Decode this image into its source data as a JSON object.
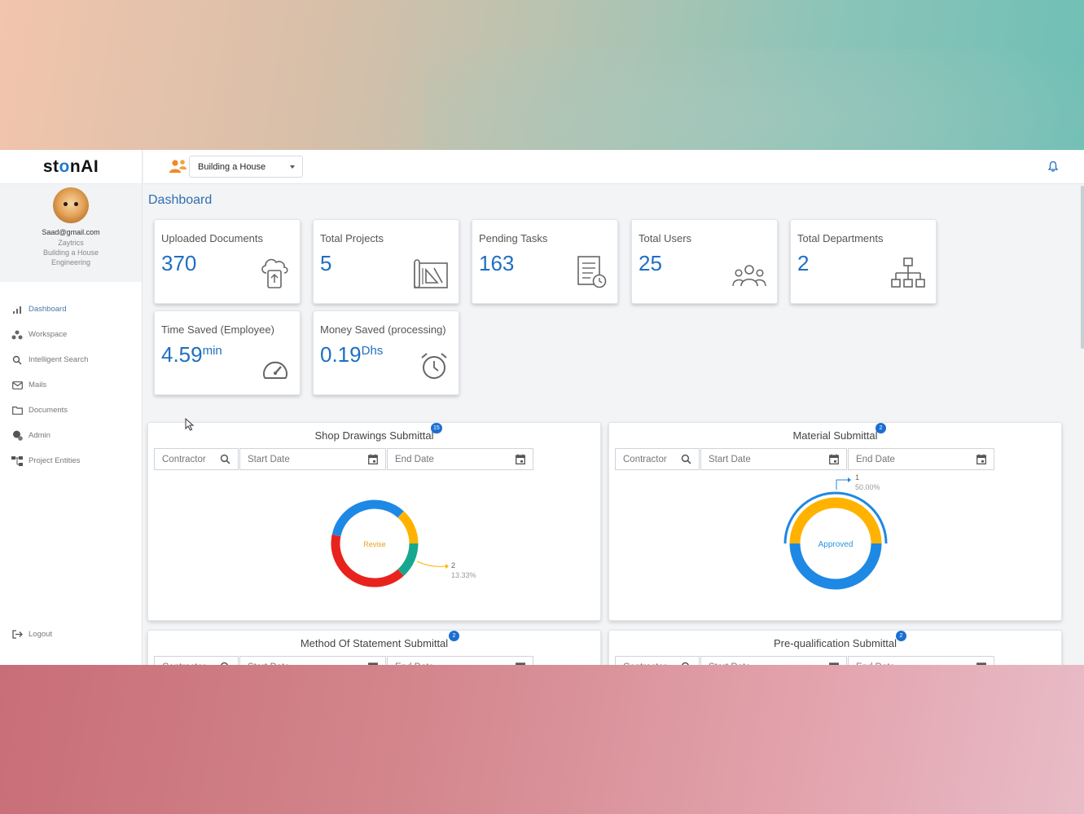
{
  "app": {
    "logo": {
      "pre": "st",
      "o": "o",
      "post": "nAI"
    }
  },
  "profile": {
    "email": "Saad@gmail.com",
    "company": "Zaytrics",
    "project": "Building a House",
    "department": "Engineering"
  },
  "nav": {
    "items": [
      {
        "label": "Dashboard",
        "icon": "bar-chart-icon"
      },
      {
        "label": "Workspace",
        "icon": "workspace-icon"
      },
      {
        "label": "Intelligent Search",
        "icon": "search-icon"
      },
      {
        "label": "Mails",
        "icon": "mail-icon"
      },
      {
        "label": "Documents",
        "icon": "folder-icon"
      },
      {
        "label": "Admin",
        "icon": "admin-icon"
      },
      {
        "label": "Project Entities",
        "icon": "hierarchy-icon"
      }
    ],
    "logout": "Logout"
  },
  "topbar": {
    "project_select": "Building a House"
  },
  "page": {
    "title": "Dashboard"
  },
  "stats": [
    {
      "label": "Uploaded Documents",
      "value": "370",
      "unit": "",
      "icon": "cloud-upload-icon"
    },
    {
      "label": "Total Projects",
      "value": "5",
      "unit": "",
      "icon": "blueprint-icon"
    },
    {
      "label": "Pending Tasks",
      "value": "163",
      "unit": "",
      "icon": "task-clock-icon"
    },
    {
      "label": "Total Users",
      "value": "25",
      "unit": "",
      "icon": "users-icon"
    },
    {
      "label": "Total Departments",
      "value": "2",
      "unit": "",
      "icon": "org-chart-icon"
    },
    {
      "label": "Time Saved (Employee)",
      "value": "4.59",
      "unit": "min",
      "icon": "speedometer-icon"
    },
    {
      "label": "Money Saved (processing)",
      "value": "0.19",
      "unit": "Dhs",
      "icon": "alarm-clock-icon"
    }
  ],
  "filters": {
    "contractor": "Contractor",
    "start_date": "Start Date",
    "end_date": "End Date"
  },
  "panels": [
    {
      "title": "Shop Drawings Submittal",
      "badge": "15",
      "center_label": "Revise",
      "callout_count": "2",
      "callout_pct": "13.33%"
    },
    {
      "title": "Material Submittal",
      "badge": "2",
      "center_label": "Approved",
      "callout_count": "1",
      "callout_pct": "50.00%"
    },
    {
      "title": "Method Of Statement Submittal",
      "badge": "2"
    },
    {
      "title": "Pre-qualification Submittal",
      "badge": "2"
    }
  ],
  "chart_data": [
    {
      "type": "pie",
      "title": "Shop Drawings Submittal",
      "total": 15,
      "slices": [
        {
          "color": "#1e88e5",
          "value": 5
        },
        {
          "color": "#ffb300",
          "value": 2,
          "label": "2",
          "pct": "13.33%"
        },
        {
          "color": "#15a88f",
          "value": 2
        },
        {
          "color": "#e8231e",
          "value": 6
        }
      ],
      "center_label": "Revise"
    },
    {
      "type": "pie",
      "title": "Material Submittal",
      "total": 2,
      "slices": [
        {
          "color": "#1e88e5",
          "value": 1,
          "label": "1",
          "pct": "50.00%"
        },
        {
          "color": "#ffb300",
          "value": 1
        }
      ],
      "center_label": "Approved"
    }
  ],
  "colors": {
    "accent": "#1f6fc2",
    "title_blue": "#2f6fb0",
    "badge": "#1c6fd1"
  }
}
